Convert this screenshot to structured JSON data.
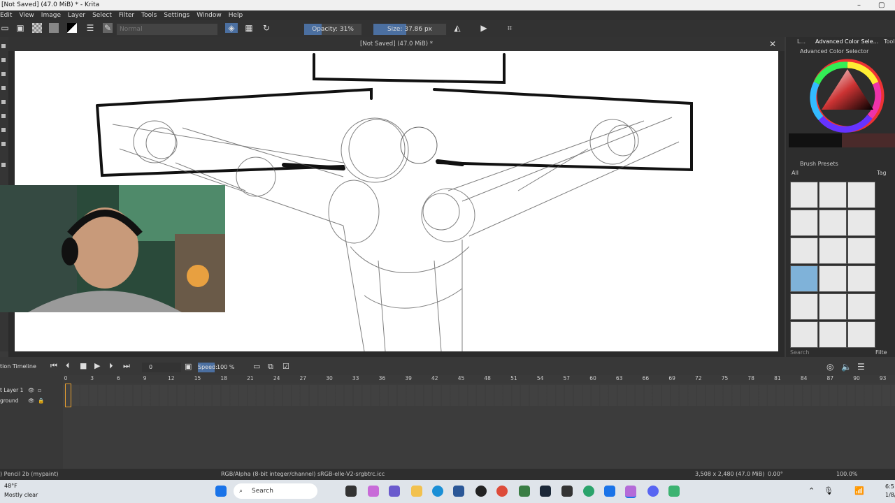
{
  "window": {
    "title": "[Not Saved]  (47.0 MiB) * - Krita"
  },
  "menu": [
    "Edit",
    "View",
    "Image",
    "Layer",
    "Select",
    "Filter",
    "Tools",
    "Settings",
    "Window",
    "Help"
  ],
  "toolbar": {
    "blend_mode": "Normal",
    "opacity_label": "Opacity: 31%",
    "opacity_value": 0.31,
    "size_label": "Size: 37.86 px"
  },
  "document": {
    "tab_title": "[Not Saved]  (47.0 MiB) *"
  },
  "dock": {
    "tabs": [
      "L...",
      "Advanced Color Sele...",
      "Tool"
    ],
    "color_selector_title": "Advanced Color Selector",
    "brush_presets_title": "Brush Presets",
    "filter_all": "All",
    "tag_label": "Tag",
    "search_placeholder": "Search",
    "filter_label": "Filte"
  },
  "timeline": {
    "title": "tion Timeline",
    "frame_value": "0",
    "speed_label": "Speed:",
    "speed_value": "100 %",
    "ticks": [
      "0",
      "3",
      "6",
      "9",
      "12",
      "15",
      "18",
      "21",
      "24",
      "27",
      "30",
      "33",
      "36",
      "39",
      "42",
      "45",
      "48",
      "51",
      "54",
      "57",
      "60",
      "63",
      "66",
      "69",
      "72",
      "75",
      "78",
      "81",
      "84",
      "87",
      "90",
      "93"
    ],
    "layers": [
      "t Layer 1",
      "ground"
    ]
  },
  "status": {
    "brush": ") Pencil 2b (mypaint)",
    "color_info": "RGB/Alpha (8-bit integer/channel)  sRGB-elle-V2-srgbtrc.icc",
    "dimensions": "3,508 x 2,480 (47.0 MiB)",
    "rotation": "0.00°",
    "zoom": "100.0%"
  },
  "taskbar": {
    "weather_temp": "48°F",
    "weather_desc": "Mostly clear",
    "search_label": "Search",
    "time": "6:5",
    "date": "1/8/"
  }
}
